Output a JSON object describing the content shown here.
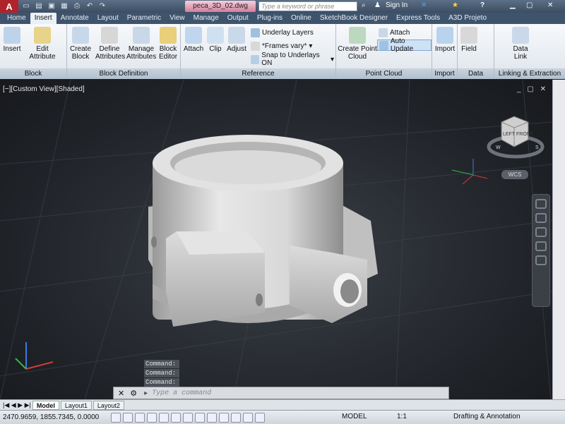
{
  "titlebar": {
    "logo": "A",
    "document_title": "peca_3D_02.dwg",
    "search_placeholder": "Type a keyword or phrase",
    "sign_in": "Sign In",
    "help": "?"
  },
  "tabs": [
    "Home",
    "Insert",
    "Annotate",
    "Layout",
    "Parametric",
    "View",
    "Manage",
    "Output",
    "Plug-ins",
    "Online",
    "SketchBook Designer",
    "Express Tools",
    "A3D Projeto"
  ],
  "active_tab": "Insert",
  "ribbon": {
    "block": {
      "title": "Block",
      "insert": "Insert",
      "edit_attribute": "Edit Attribute"
    },
    "block_definition": {
      "title": "Block Definition",
      "create_block": "Create Block",
      "define_attributes": "Define Attributes",
      "manage_attributes": "Manage Attributes",
      "block_editor": "Block Editor"
    },
    "reference": {
      "title": "Reference",
      "attach": "Attach",
      "clip": "Clip",
      "adjust": "Adjust",
      "underlay_layers": "Underlay Layers",
      "frames_vary": "*Frames vary*",
      "snap_underlays": "Snap to Underlays ON"
    },
    "point_cloud": {
      "title": "Point Cloud",
      "create_point_cloud": "Create Point Cloud",
      "attach": "Attach",
      "auto_update": "Auto Update"
    },
    "import": {
      "title": "Import",
      "import": "Import"
    },
    "data": {
      "title": "Data",
      "field": "Field",
      "data_link": "Data Link"
    },
    "linking": {
      "title": "Linking & Extraction"
    }
  },
  "viewport": {
    "label": "[−][Custom View][Shaded]",
    "wcs": "WCS",
    "cube_left": "LEFT",
    "cube_front": "FRONT",
    "compass_w": "W",
    "compass_s": "S"
  },
  "command": {
    "history": [
      "Command:",
      "Command:",
      "Command:"
    ],
    "placeholder": "Type a command"
  },
  "layout_tabs": [
    "Model",
    "Layout1",
    "Layout2"
  ],
  "status": {
    "coords": "2470.9659, 1855.7345, 0.0000",
    "model": "MODEL",
    "scale": "1:1",
    "workspace": "Drafting & Annotation"
  },
  "colors": {
    "title_bg": "#3c4d62",
    "doc_tab": "#d37f9a",
    "ribbon_bg": "#eaeef2",
    "viewport_bg": "#2a2e34",
    "model_gray": "#c8c8c8"
  }
}
